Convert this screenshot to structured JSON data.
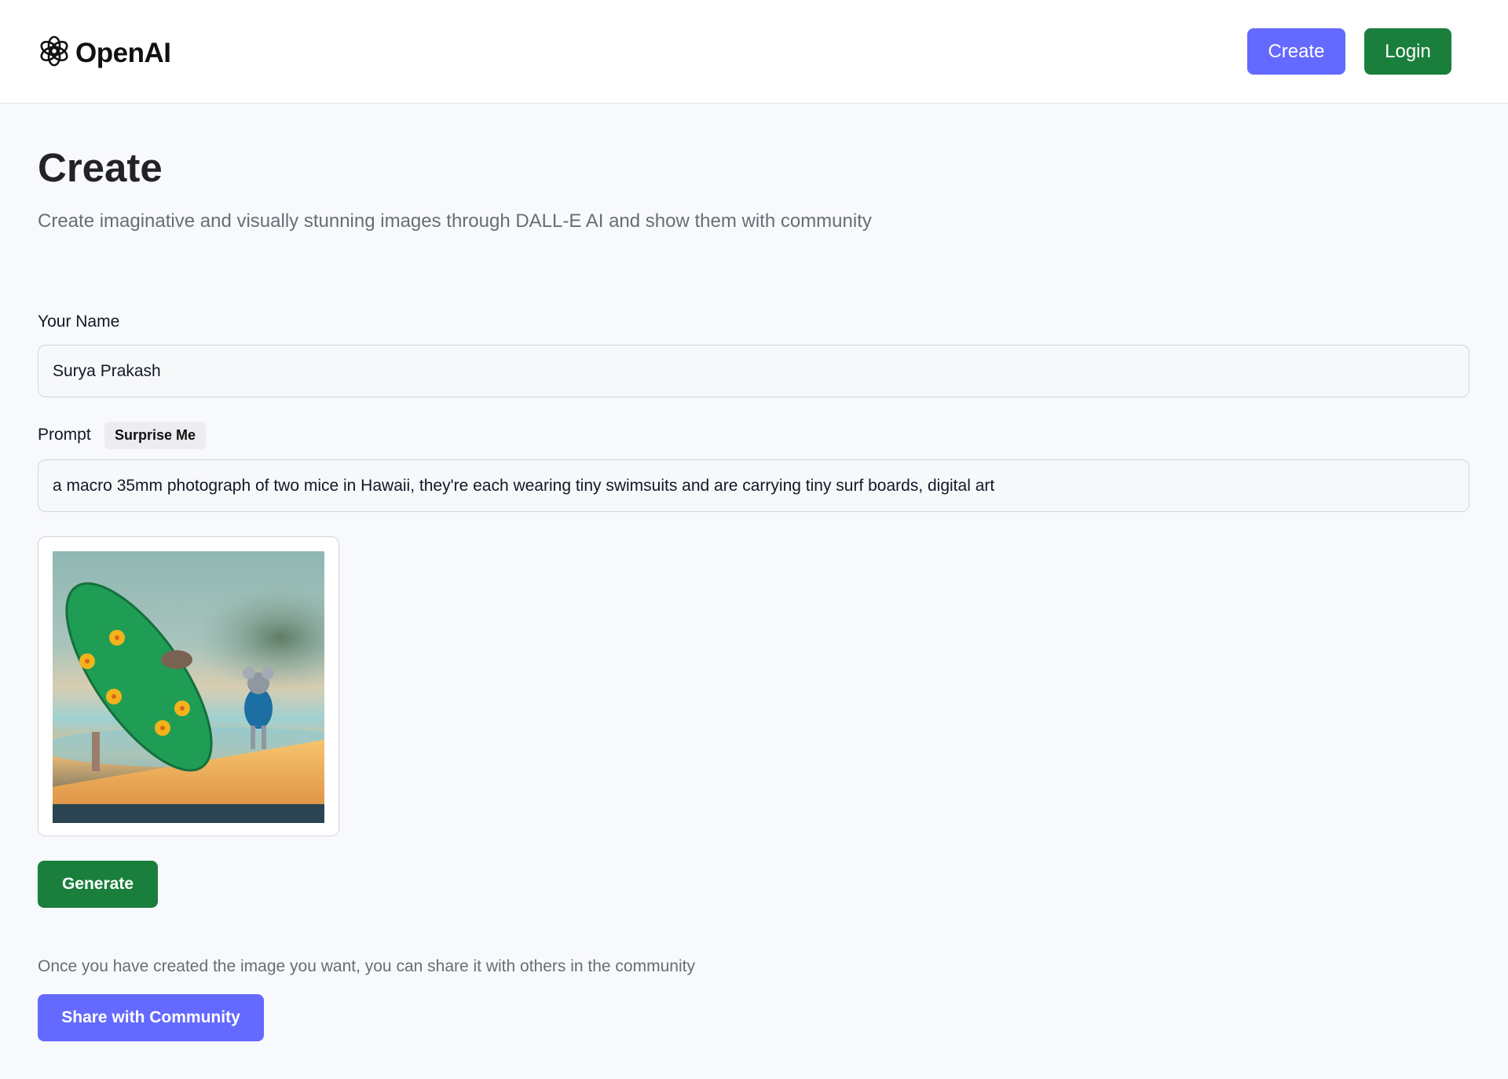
{
  "header": {
    "brand": "OpenAI",
    "logo_icon": "openai-logo-icon",
    "create_label": "Create",
    "login_label": "Login"
  },
  "main": {
    "title": "Create",
    "subtitle": "Create imaginative and visually stunning images through DALL-E AI and show them with community"
  },
  "form": {
    "name_label": "Your Name",
    "name_value": "Surya Prakash",
    "prompt_label": "Prompt",
    "surprise_label": "Surprise Me",
    "prompt_value": "a macro 35mm photograph of two mice in Hawaii, they're each wearing tiny swimsuits and are carrying tiny surf boards, digital art",
    "generate_label": "Generate",
    "share_note": "Once you have created the image you want, you can share it with others in the community",
    "share_label": "Share with Community"
  },
  "colors": {
    "accent": "#6469ff",
    "primary_green": "#1a7f3c",
    "background": "#f8f9fc"
  }
}
